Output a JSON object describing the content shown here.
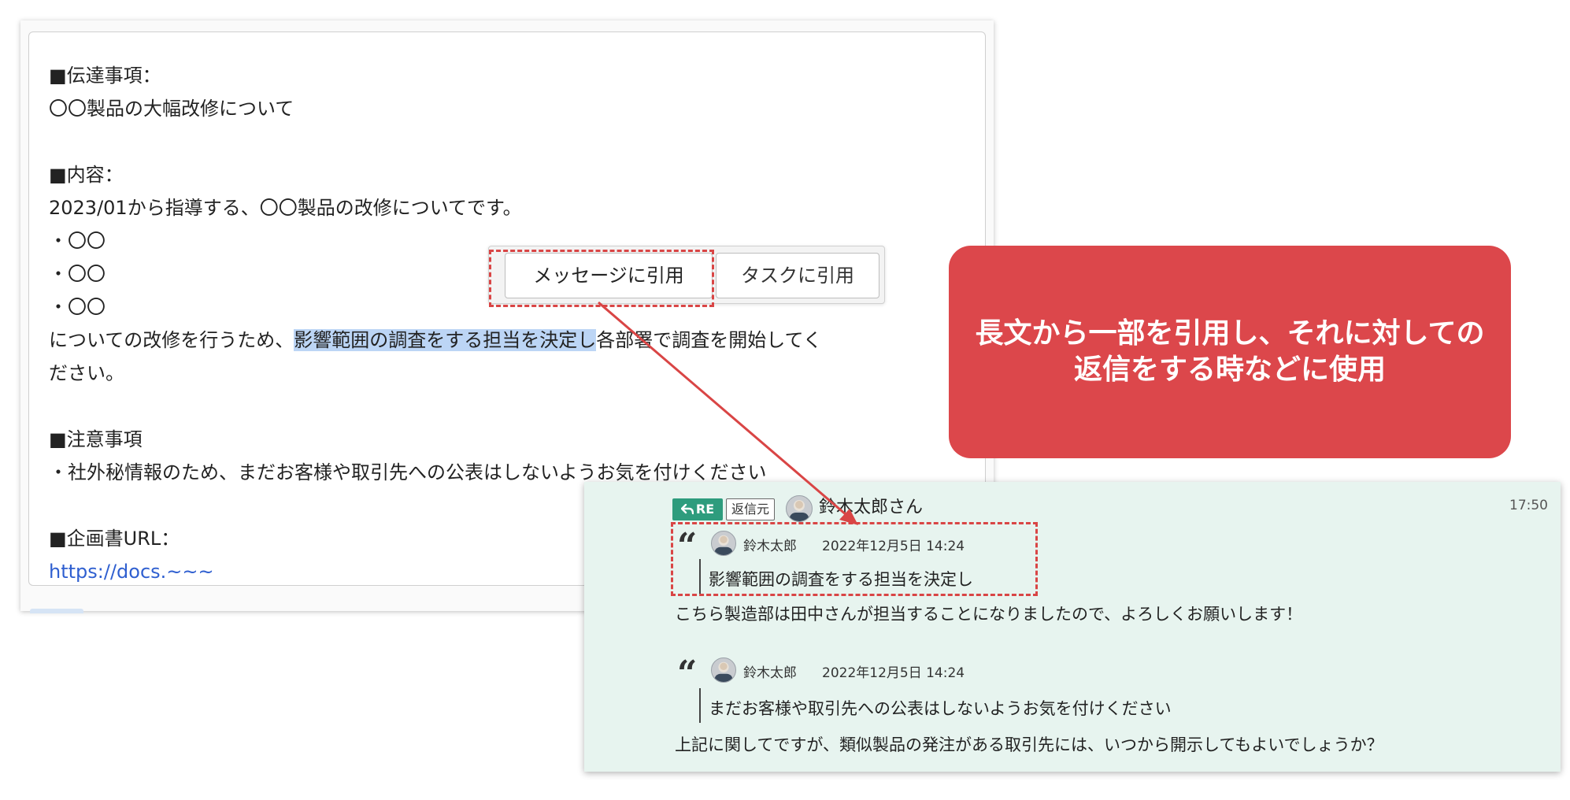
{
  "message": {
    "lines": [
      "■伝達事項：",
      "〇〇製品の大幅改修について",
      "",
      "■内容：",
      "2023/01から指導する、〇〇製品の改修についてです。",
      "・〇〇",
      "・〇〇",
      "・〇〇",
      "",
      "ださい。",
      "",
      "■注意事項",
      "・社外秘情報のため、まだお客様や取引先への公表はしないようお気を付けください",
      "",
      "■企画書URL：",
      "https://docs.~~~"
    ],
    "line9_before": "についての改修を行うため、",
    "line9_highlight": "影響範囲の調査をする担当を決定し",
    "line9_after": "各部署で調査を開始してく"
  },
  "quote_menu": {
    "message_quote_label": "メッセージに引用",
    "task_quote_label": "タスクに引用"
  },
  "callout": {
    "text": "長文から一部を引用し、それに対しての返信をする時などに使用",
    "color": "#dc474b"
  },
  "reply": {
    "re_label": "RE",
    "reply_source_label": "返信元",
    "sender": "鈴木太郎さん",
    "time": "17:50",
    "quotes": [
      {
        "author": "鈴木太郎",
        "date": "2022年12月5日 14:24",
        "text": "影響範囲の調査をする担当を決定し",
        "response": "こちら製造部は田中さんが担当することになりましたので、よろしくお願いします！"
      },
      {
        "author": "鈴木太郎",
        "date": "2022年12月5日 14:24",
        "text": "まだお客様や取引先への公表はしないようお気を付けください",
        "response": "上記に関してですが、類似製品の発注がある取引先には、いつから開示してもよいでしょうか？"
      }
    ],
    "background": "#e7f4ef",
    "badge_color": "#2e9c7d"
  },
  "icons": [
    "reply-arrow-icon",
    "avatar-icon",
    "quote-mark-icon"
  ]
}
